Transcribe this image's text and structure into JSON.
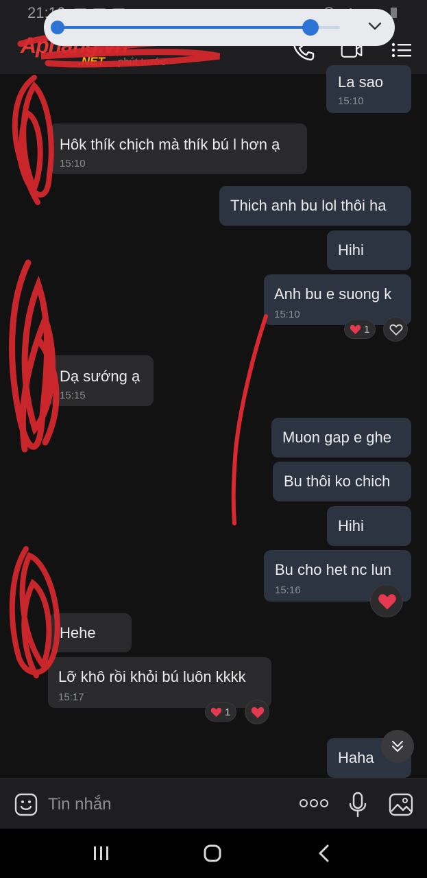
{
  "status": {
    "time": "21:16"
  },
  "watermark": {
    "brand": "Aphang.vn",
    "tld": ".NET"
  },
  "header": {
    "subtitle": "phút trước"
  },
  "messages": [
    {
      "dir": "out",
      "text": "La sao",
      "time": "15:10"
    },
    {
      "dir": "in",
      "text": "Hôk thík chịch mà thík bú l hơn ạ",
      "time": "15:10"
    },
    {
      "dir": "out",
      "text": "Thich anh bu lol thôi ha",
      "time": ""
    },
    {
      "dir": "out",
      "text": "Hihi",
      "time": ""
    },
    {
      "dir": "out",
      "text": "Anh bu e suong k",
      "time": "15:10"
    },
    {
      "dir": "in",
      "text": "Dạ sướng ạ",
      "time": "15:15"
    },
    {
      "dir": "out",
      "text": "Muon gap e ghe",
      "time": ""
    },
    {
      "dir": "out",
      "text": "Bu thôi ko chich",
      "time": ""
    },
    {
      "dir": "out",
      "text": "Hihi",
      "time": ""
    },
    {
      "dir": "out",
      "text": "Bu cho het nc lun",
      "time": "15:16"
    },
    {
      "dir": "in",
      "text": "Hehe",
      "time": ""
    },
    {
      "dir": "in",
      "text": "Lỡ khô rồi khỏi bú luôn kkkk",
      "time": "15:17"
    },
    {
      "dir": "out",
      "text": "Haha",
      "time": ""
    }
  ],
  "reactions": {
    "msg5_count": "1",
    "msg12_count": "1"
  },
  "input": {
    "placeholder": "Tin nhắn"
  },
  "icons": [
    "phone-icon",
    "video-call-icon",
    "menu-icon",
    "emoji-icon",
    "more-icon",
    "microphone-icon",
    "image-icon",
    "recent-apps-icon",
    "home-icon",
    "back-icon",
    "chevron-down-icon",
    "heart-icon",
    "heart-outline-icon",
    "double-chevron-down-icon"
  ],
  "colors": {
    "outgoing_bubble": "#2b3440",
    "incoming_bubble": "#2a2a2c",
    "heart": "#e53950",
    "accent": "#2b74d6"
  }
}
